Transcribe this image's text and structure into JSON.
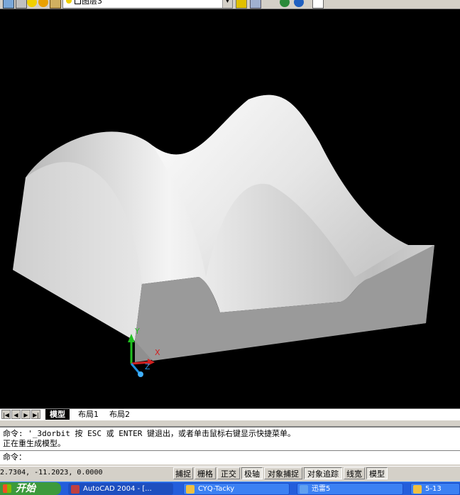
{
  "toolbar": {
    "layer_name": "图层3",
    "icons": [
      "layer-manager-icon",
      "layer-state-icon",
      "lightbulb-icon",
      "sun-icon",
      "lock-icon",
      "match-layer-icon",
      "layer-previous-icon",
      "realtime-pan-icon",
      "globe-icon",
      "zoom-window-icon"
    ]
  },
  "model": {
    "background_color": "#000000",
    "solid_color": "#c8c8c8",
    "ucs_labels": {
      "x": "X",
      "y": "Y",
      "z": "Z"
    }
  },
  "tabs": {
    "nav": [
      "|◀",
      "◀",
      "▶",
      "▶|"
    ],
    "items": [
      "模型",
      "布局1",
      "布局2"
    ]
  },
  "command": {
    "line1": "命令: '_3dorbit 按 ESC 或 ENTER 键退出，或者单击鼠标右键显示快捷菜单。",
    "line2": "正在重生成模型。",
    "prompt": "命令："
  },
  "status": {
    "coords": "2.7304, -11.2023, 0.0000",
    "toggles": [
      {
        "label": "捕捉",
        "on": false
      },
      {
        "label": "栅格",
        "on": false
      },
      {
        "label": "正交",
        "on": false
      },
      {
        "label": "极轴",
        "on": true
      },
      {
        "label": "对象捕捉",
        "on": false
      },
      {
        "label": "对象追踪",
        "on": true
      },
      {
        "label": "线宽",
        "on": false
      },
      {
        "label": "模型",
        "on": true
      }
    ]
  },
  "taskbar": {
    "start": "开始",
    "tasks": [
      "AutoCAD 2004 - [...",
      "CYQ-Tacky",
      "迅雷5",
      "5-13"
    ]
  }
}
